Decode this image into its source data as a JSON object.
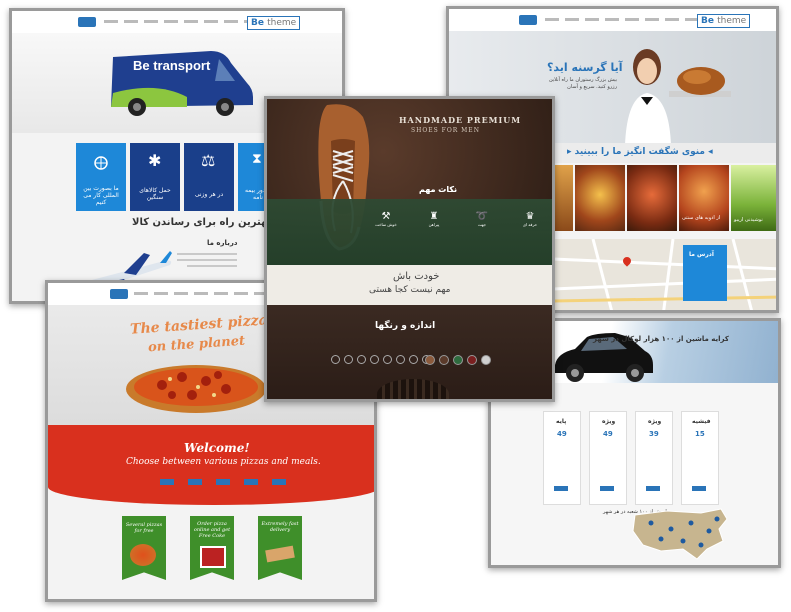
{
  "brand": {
    "prefix": "Be",
    "suffix": "theme"
  },
  "transport": {
    "van_label": "Be transport",
    "tiles": [
      "ما بصورت بین المللی کار می کنیم",
      "حمل کالاهای سنگین",
      "در هر وزنی",
      "صدور بیمه نامه"
    ],
    "headline": "بهترین راه برای رساندن کالا",
    "subheading": "درباره ما"
  },
  "restaurant": {
    "question": "آیا گرسنه اید؟",
    "intro": "بیش بزرگ رستوران ما راه آنلاین رزرو کنید. سریع و آسان",
    "menu_heading": "◂ منوی شگفت انگیز ما را ببینید ▸",
    "dishes": [
      "",
      "",
      "",
      "از ادویه های سنتی",
      "نوشیدنی اریبو"
    ],
    "contact": "آدرس ما"
  },
  "shoes": {
    "title_line1": "HANDMADE PREMIUM",
    "title_line2": "SHOES FOR MEN",
    "section_tips": "نکات مهم",
    "icons": [
      "حرفه ای",
      "جهت",
      "پیراهن",
      "خوش ساخت"
    ],
    "slogan_line1": "خودت باش",
    "slogan_line2": "مهم نیست کجا هستی",
    "sizes_heading": "اندازه و رنگها",
    "sizes": [
      "",
      "",
      "",
      "",
      "",
      "",
      "",
      ""
    ],
    "swatch_colors": [
      "#8b5a3c",
      "#5a3a2a",
      "#2e6b3e",
      "#7a1f1f",
      "#cfcfcf"
    ]
  },
  "pizza": {
    "hero_line1": "The tastiest pizza",
    "hero_line2": "on the planet",
    "welcome_line1": "Welcome!",
    "welcome_line2": "Choose between various pizzas and meals.",
    "buttons": [
      "",
      "",
      "",
      "",
      ""
    ],
    "features": [
      "Several pizzas for free",
      "Order pizza online and get Free Coke",
      "Extremely fast delivery"
    ]
  },
  "rental": {
    "headline": "کرایه ماشین از ۱۰۰ هزار لوکال در شهر",
    "plans": [
      {
        "name": "پایه",
        "price": "49"
      },
      {
        "name": "ویژه",
        "price": "49"
      },
      {
        "name": "ویژه",
        "price": "39"
      },
      {
        "name": "فیشیه",
        "price": "15"
      }
    ],
    "map_caption": "ما بیش از ۱۰۰ شعبه در هر شهر"
  },
  "colors": {
    "blue": "#2a74b8",
    "red": "#d9301e",
    "green": "#2e7d32",
    "brown": "#4a2f22"
  }
}
